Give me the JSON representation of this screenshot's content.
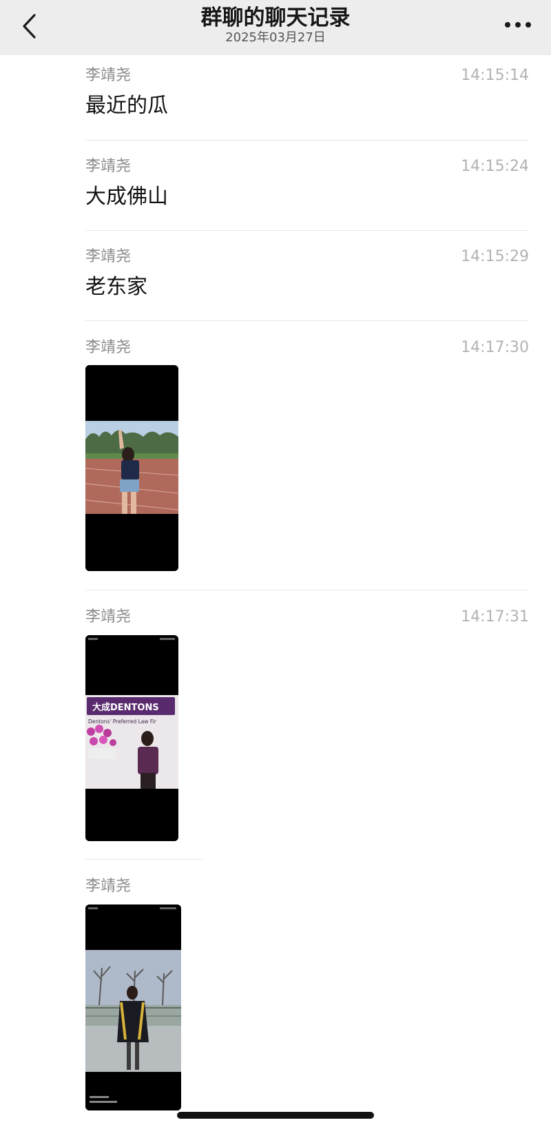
{
  "header": {
    "title": "群聊的聊天记录",
    "date": "2025年03月27日"
  },
  "messages": [
    {
      "sender": "李靖尧",
      "time": "14:15:14",
      "text": "最近的瓜"
    },
    {
      "sender": "李靖尧",
      "time": "14:15:24",
      "text": "大成佛山"
    },
    {
      "sender": "李靖尧",
      "time": "14:15:29",
      "text": "老东家"
    },
    {
      "sender": "李靖尧",
      "time": "14:17:30",
      "image": "photo-track-field"
    },
    {
      "sender": "李靖尧",
      "time": "14:17:31",
      "image": "photo-dentons-office",
      "banner": "大成DENTONS",
      "banner_sub": "Dentons' Preferred Law Fir"
    },
    {
      "sender": "李靖尧",
      "image": "photo-graduation"
    }
  ],
  "colors": {
    "header_bg": "#ededed",
    "sender": "#8a8a8a",
    "time": "#b2b2b2",
    "divider": "#e6e6e6",
    "banner": "#5a2a6e"
  }
}
